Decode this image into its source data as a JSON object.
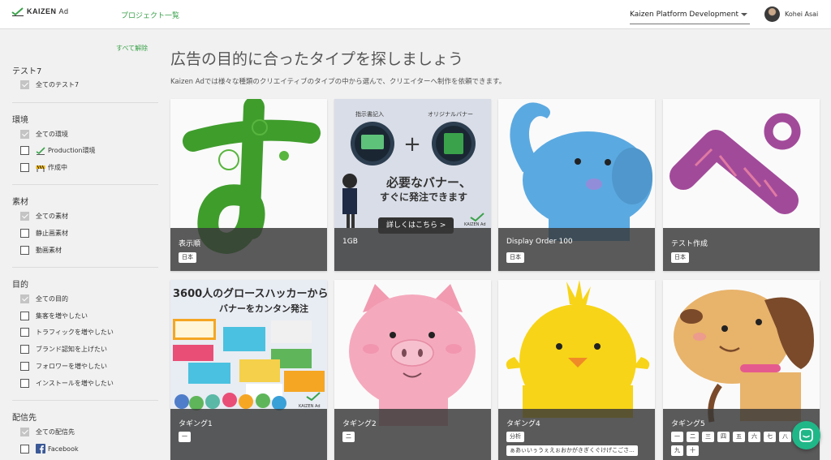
{
  "header": {
    "logo_text": "KAIZEN",
    "logo_suffix": "Ad",
    "nav_link": "プロジェクト一覧",
    "project": "Kaizen Platform Development",
    "user_name": "Kohei Asai"
  },
  "sidebar": {
    "clear_all": "すべて解除",
    "groups": [
      {
        "title": "テスト7",
        "items": [
          {
            "label": "全てのテスト7",
            "checked": true
          }
        ]
      },
      {
        "title": "環境",
        "items": [
          {
            "label": "全ての環境",
            "checked": true
          },
          {
            "label": "Production環境",
            "checked": false,
            "icon": "kaizen-check-icon"
          },
          {
            "label": "作成中",
            "checked": false,
            "icon": "construction-barrier-icon"
          }
        ]
      },
      {
        "title": "素材",
        "items": [
          {
            "label": "全ての素材",
            "checked": true
          },
          {
            "label": "静止画素材",
            "checked": false
          },
          {
            "label": "動画素材",
            "checked": false
          }
        ]
      },
      {
        "title": "目的",
        "items": [
          {
            "label": "全ての目的",
            "checked": true
          },
          {
            "label": "集客を増やしたい",
            "checked": false
          },
          {
            "label": "トラフィックを増やしたい",
            "checked": false
          },
          {
            "label": "ブランド認知を上げたい",
            "checked": false
          },
          {
            "label": "フォロワーを増やしたい",
            "checked": false
          },
          {
            "label": "インストールを増やしたい",
            "checked": false
          }
        ]
      },
      {
        "title": "配信先",
        "items": [
          {
            "label": "全ての配信先",
            "checked": true
          },
          {
            "label": "Facebook",
            "checked": false,
            "icon": "facebook-icon"
          }
        ]
      }
    ]
  },
  "main": {
    "title": "広告の目的に合ったタイプを探しましょう",
    "description": "Kaizen Adでは様々な種類のクリエイティブのタイプの中から選んで、クリエイターへ制作を依頼できます。",
    "cards": [
      {
        "name": "表示順",
        "tags": [
          "日本"
        ],
        "art": "green-su-character"
      },
      {
        "name": "1GB",
        "tags": [],
        "art": "banner-order-promo",
        "art_text": {
          "left_label": "指示書記入",
          "right_label": "オリジナルバナー",
          "headline1": "必要なバナー、",
          "headline2": "すぐに発注できます",
          "cta": "詳しくはこちら >",
          "brand": "KAIZEN Ad"
        }
      },
      {
        "name": "Display Order 100",
        "tags": [
          "日本"
        ],
        "art": "blue-elephant"
      },
      {
        "name": "テスト作成",
        "tags": [
          "日本"
        ],
        "art": "purple-pe-character"
      },
      {
        "name": "タギング1",
        "tags": [
          "一"
        ],
        "art": "growth-hacker-banner",
        "art_text": {
          "headline1": "3600人のグロースハッカーから",
          "headline2": "バナーをカンタン発注",
          "brand": "KAIZEN Ad"
        }
      },
      {
        "name": "タギング2",
        "tags": [
          "二"
        ],
        "art": "pink-pig"
      },
      {
        "name": "タギング4",
        "tags": [
          "分析",
          "ぁあぃいぅうぇえぉおかがきぎくぐけげこごさ..."
        ],
        "art": "yellow-chick"
      },
      {
        "name": "タギング5",
        "tags": [
          "一",
          "二",
          "三",
          "四",
          "五",
          "六",
          "七",
          "八",
          "九",
          "十"
        ],
        "art": "brown-dog"
      }
    ]
  },
  "colors": {
    "accent": "#3aa24b",
    "chat": "#20b788",
    "overlay": "#373737"
  },
  "chat_button": {
    "icon": "chat-icon"
  }
}
